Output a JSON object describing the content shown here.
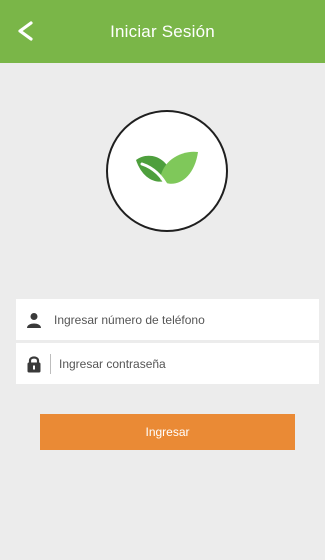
{
  "header": {
    "back_icon": "chevron-left-icon",
    "title": "Iniciar Sesión"
  },
  "logo": {
    "icon": "leaves-icon"
  },
  "form": {
    "phone": {
      "icon": "user-icon",
      "placeholder": "Ingresar número de teléfono",
      "value": ""
    },
    "password": {
      "icon": "lock-icon",
      "placeholder": "Ingresar contraseña",
      "value": ""
    },
    "submit_label": "Ingresar"
  },
  "colors": {
    "header_bg": "#7ab648",
    "page_bg": "#ececec",
    "button_bg": "#ea8a35",
    "leaf_green": "#6cbc4a"
  }
}
